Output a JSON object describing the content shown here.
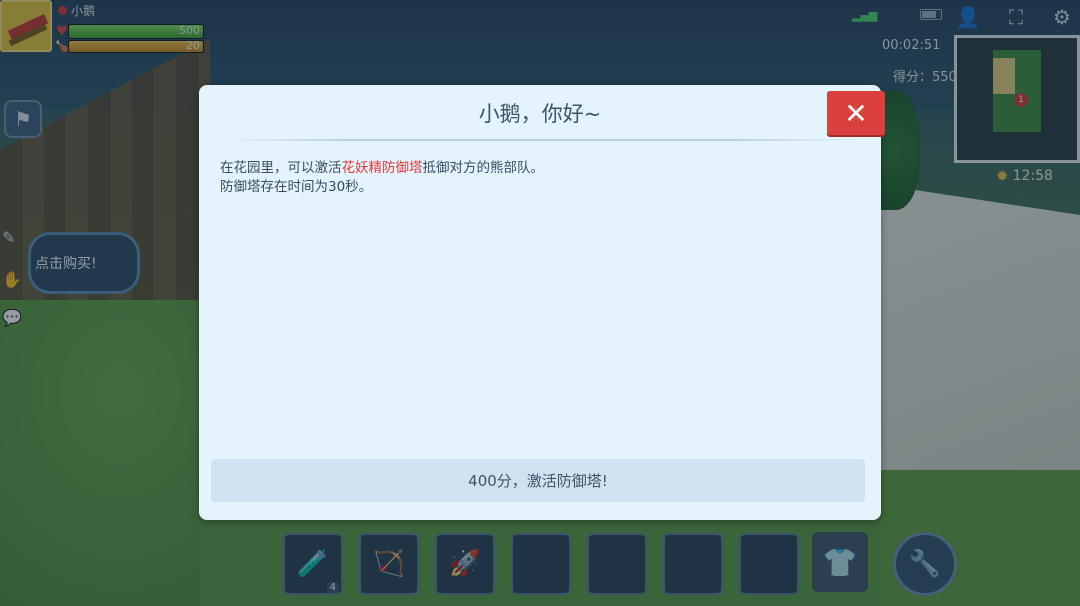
{
  "player": {
    "name": "小鹅",
    "hp_text": "500",
    "hp_level": 1.0,
    "hunger_text": "20",
    "hunger_level": 1.0
  },
  "hud": {
    "timer": "00:02:51",
    "score_text": "得分：550",
    "clock_text": "12:58",
    "minimap_marker": "1"
  },
  "side": {
    "speech_text": "点击购买!"
  },
  "hotbar": {
    "potion_count": "4"
  },
  "dialog": {
    "title": "小鹅，你好~",
    "line1_pre": "在花园里，可以激活",
    "line1_highlight": "花妖精防御塔",
    "line1_post": "抵御对方的熊部队。",
    "line2_pre": "防御塔存在时间为",
    "line2_value": "30秒",
    "line2_post": "。",
    "activate_label": "400分，激活防御塔!",
    "close_glyph": "✕",
    "highlight_color": "#e33b3b"
  },
  "icons": [
    "heart-icon",
    "hunger-icon",
    "signal-icon",
    "battery-icon",
    "player-info-icon",
    "screenshot-icon",
    "settings-gear-icon",
    "sun-icon",
    "flag-icon",
    "potion-icon",
    "crossbow-icon",
    "rocket-icon",
    "bag-icon",
    "wrench-icon",
    "close-icon"
  ]
}
